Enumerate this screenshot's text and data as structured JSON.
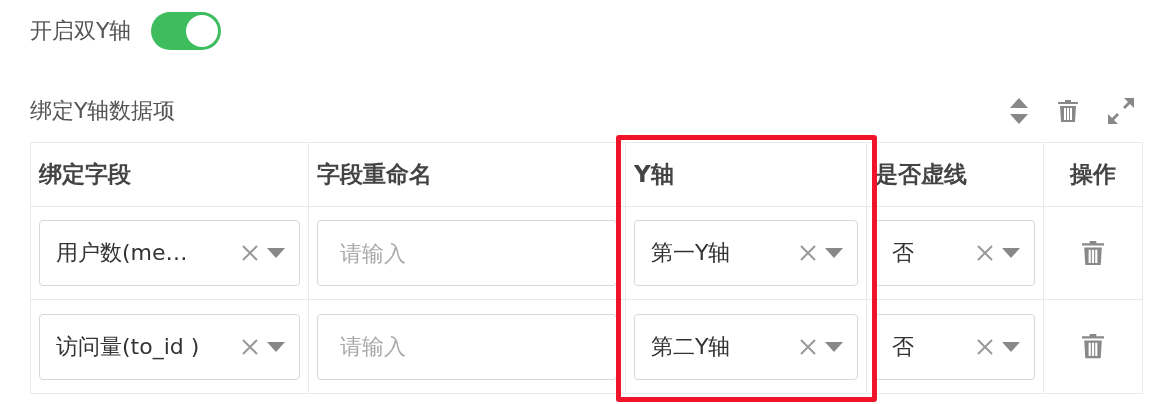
{
  "toggle": {
    "label": "开启双Y轴",
    "on": true
  },
  "section": {
    "title": "绑定Y轴数据项"
  },
  "table": {
    "columns": [
      {
        "label": "绑定字段",
        "highlighted": false
      },
      {
        "label": "字段重命名",
        "highlighted": false
      },
      {
        "label": "Y轴",
        "highlighted": true
      },
      {
        "label": "是否虚线",
        "highlighted": false
      },
      {
        "label": "操作",
        "highlighted": false
      }
    ],
    "rows": [
      {
        "field": "用户数(me…",
        "rename_placeholder": "请输入",
        "axis": "第一Y轴",
        "dashed": "否"
      },
      {
        "field": "访问量(to_id )",
        "rename_placeholder": "请输入",
        "axis": "第二Y轴",
        "dashed": "否"
      }
    ]
  }
}
